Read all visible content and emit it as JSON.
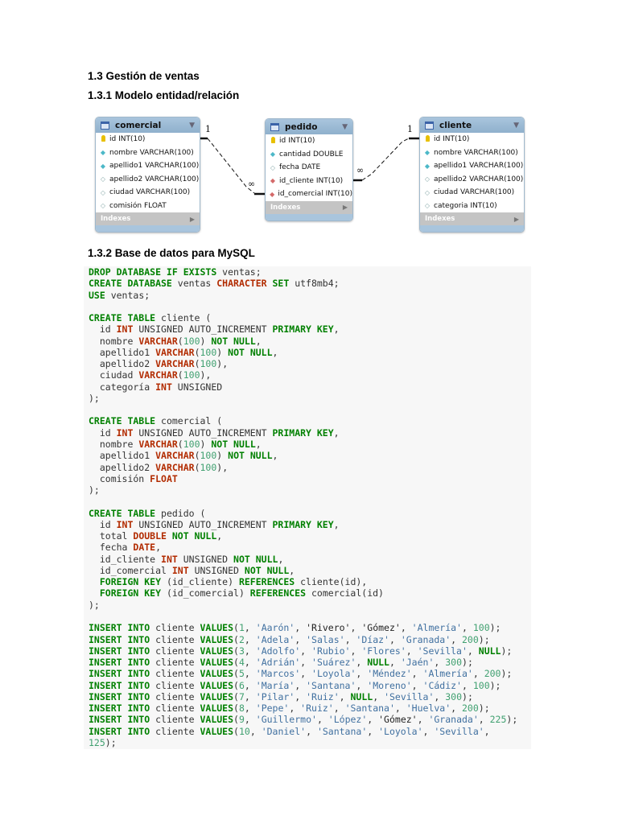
{
  "headings": {
    "section": "1.3 Gestión de ventas",
    "er_model": "1.3.1 Modelo entidad/relación",
    "mysql": "1.3.2 Base de datos para MySQL"
  },
  "diagram": {
    "indexes_label": "Indexes",
    "relations": [
      {
        "from": "comercial",
        "to": "pedido",
        "one_label": "1",
        "many_label": "∞"
      },
      {
        "from": "cliente",
        "to": "pedido",
        "one_label": "1",
        "many_label": "∞"
      }
    ],
    "entities": [
      {
        "name": "comercial",
        "columns": [
          {
            "icon": "key",
            "text": "id INT(10)"
          },
          {
            "icon": "nn",
            "text": "nombre VARCHAR(100)"
          },
          {
            "icon": "nn",
            "text": "apellido1 VARCHAR(100)"
          },
          {
            "icon": "nul",
            "text": "apellido2 VARCHAR(100)"
          },
          {
            "icon": "nul",
            "text": "ciudad VARCHAR(100)"
          },
          {
            "icon": "nul",
            "text": "comisión FLOAT"
          }
        ]
      },
      {
        "name": "pedido",
        "columns": [
          {
            "icon": "key",
            "text": "id INT(10)"
          },
          {
            "icon": "nn",
            "text": "cantidad DOUBLE"
          },
          {
            "icon": "nul",
            "text": "fecha DATE"
          },
          {
            "icon": "fk",
            "text": "id_cliente INT(10)"
          },
          {
            "icon": "fk",
            "text": "id_comercial INT(10)"
          }
        ]
      },
      {
        "name": "cliente",
        "columns": [
          {
            "icon": "key",
            "text": "id INT(10)"
          },
          {
            "icon": "nn",
            "text": "nombre VARCHAR(100)"
          },
          {
            "icon": "nn",
            "text": "apellido1 VARCHAR(100)"
          },
          {
            "icon": "nul",
            "text": "apellido2 VARCHAR(100)"
          },
          {
            "icon": "nul",
            "text": "ciudad VARCHAR(100)"
          },
          {
            "icon": "nul",
            "text": "categoria INT(10)"
          }
        ]
      }
    ]
  },
  "code": {
    "colors": {
      "keyword": "#008000",
      "type": "#b22b00",
      "number": "#40a070",
      "string": "#4070a0",
      "background": "#f7f7f7"
    },
    "lines": [
      [
        [
          "k",
          "DROP DATABASE IF EXISTS"
        ],
        [
          "p",
          " ventas;"
        ]
      ],
      [
        [
          "k",
          "CREATE DATABASE"
        ],
        [
          "p",
          " ventas "
        ],
        [
          "t",
          "CHARACTER"
        ],
        [
          "k",
          " SET"
        ],
        [
          "p",
          " utf8mb4;"
        ]
      ],
      [
        [
          "k",
          "USE"
        ],
        [
          "p",
          " ventas;"
        ]
      ],
      [],
      [
        [
          "k",
          "CREATE TABLE"
        ],
        [
          "p",
          " cliente ("
        ]
      ],
      [
        [
          "p",
          "  id "
        ],
        [
          "t",
          "INT"
        ],
        [
          "p",
          " UNSIGNED AUTO_INCREMENT "
        ],
        [
          "k",
          "PRIMARY KEY"
        ],
        [
          "p",
          ","
        ]
      ],
      [
        [
          "p",
          "  nombre "
        ],
        [
          "t",
          "VARCHAR"
        ],
        [
          "p",
          "("
        ],
        [
          "n",
          "100"
        ],
        [
          "p",
          ") "
        ],
        [
          "k",
          "NOT NULL"
        ],
        [
          "p",
          ","
        ]
      ],
      [
        [
          "p",
          "  apellido1 "
        ],
        [
          "t",
          "VARCHAR"
        ],
        [
          "p",
          "("
        ],
        [
          "n",
          "100"
        ],
        [
          "p",
          ") "
        ],
        [
          "k",
          "NOT NULL"
        ],
        [
          "p",
          ","
        ]
      ],
      [
        [
          "p",
          "  apellido2 "
        ],
        [
          "t",
          "VARCHAR"
        ],
        [
          "p",
          "("
        ],
        [
          "n",
          "100"
        ],
        [
          "p",
          "),"
        ]
      ],
      [
        [
          "p",
          "  ciudad "
        ],
        [
          "t",
          "VARCHAR"
        ],
        [
          "p",
          "("
        ],
        [
          "n",
          "100"
        ],
        [
          "p",
          "),"
        ]
      ],
      [
        [
          "p",
          "  categoría "
        ],
        [
          "t",
          "INT"
        ],
        [
          "p",
          " UNSIGNED"
        ]
      ],
      [
        [
          "p",
          ");"
        ]
      ],
      [],
      [
        [
          "k",
          "CREATE TABLE"
        ],
        [
          "p",
          " comercial ("
        ]
      ],
      [
        [
          "p",
          "  id "
        ],
        [
          "t",
          "INT"
        ],
        [
          "p",
          " UNSIGNED AUTO_INCREMENT "
        ],
        [
          "k",
          "PRIMARY KEY"
        ],
        [
          "p",
          ","
        ]
      ],
      [
        [
          "p",
          "  nombre "
        ],
        [
          "t",
          "VARCHAR"
        ],
        [
          "p",
          "("
        ],
        [
          "n",
          "100"
        ],
        [
          "p",
          ") "
        ],
        [
          "k",
          "NOT NULL"
        ],
        [
          "p",
          ","
        ]
      ],
      [
        [
          "p",
          "  apellido1 "
        ],
        [
          "t",
          "VARCHAR"
        ],
        [
          "p",
          "("
        ],
        [
          "n",
          "100"
        ],
        [
          "p",
          ") "
        ],
        [
          "k",
          "NOT NULL"
        ],
        [
          "p",
          ","
        ]
      ],
      [
        [
          "p",
          "  apellido2 "
        ],
        [
          "t",
          "VARCHAR"
        ],
        [
          "p",
          "("
        ],
        [
          "n",
          "100"
        ],
        [
          "p",
          "),"
        ]
      ],
      [
        [
          "p",
          "  comisión "
        ],
        [
          "t",
          "FLOAT"
        ]
      ],
      [
        [
          "p",
          ");"
        ]
      ],
      [],
      [
        [
          "k",
          "CREATE TABLE"
        ],
        [
          "p",
          " pedido ("
        ]
      ],
      [
        [
          "p",
          "  id "
        ],
        [
          "t",
          "INT"
        ],
        [
          "p",
          " UNSIGNED AUTO_INCREMENT "
        ],
        [
          "k",
          "PRIMARY KEY"
        ],
        [
          "p",
          ","
        ]
      ],
      [
        [
          "p",
          "  total "
        ],
        [
          "t",
          "DOUBLE"
        ],
        [
          "k",
          " NOT NULL"
        ],
        [
          "p",
          ","
        ]
      ],
      [
        [
          "p",
          "  fecha "
        ],
        [
          "t",
          "DATE"
        ],
        [
          "p",
          ","
        ]
      ],
      [
        [
          "p",
          "  id_cliente "
        ],
        [
          "t",
          "INT"
        ],
        [
          "p",
          " UNSIGNED "
        ],
        [
          "k",
          "NOT NULL"
        ],
        [
          "p",
          ","
        ]
      ],
      [
        [
          "p",
          "  id_comercial "
        ],
        [
          "t",
          "INT"
        ],
        [
          "p",
          " UNSIGNED "
        ],
        [
          "k",
          "NOT NULL"
        ],
        [
          "p",
          ","
        ]
      ],
      [
        [
          "k",
          "  FOREIGN KEY"
        ],
        [
          "p",
          " (id_cliente) "
        ],
        [
          "k",
          "REFERENCES"
        ],
        [
          "p",
          " cliente(id),"
        ]
      ],
      [
        [
          "k",
          "  FOREIGN KEY"
        ],
        [
          "p",
          " (id_comercial) "
        ],
        [
          "k",
          "REFERENCES"
        ],
        [
          "p",
          " comercial(id)"
        ]
      ],
      [
        [
          "p",
          ");"
        ]
      ],
      [],
      [
        [
          "k",
          "INSERT INTO"
        ],
        [
          "p",
          " cliente "
        ],
        [
          "k",
          "VALUES"
        ],
        [
          "p",
          "("
        ],
        [
          "n",
          "1"
        ],
        [
          "p",
          ", "
        ],
        [
          "s",
          "'Aarón'"
        ],
        [
          "p",
          ", "
        ],
        [
          "d",
          "'Rivero'"
        ],
        [
          "p",
          ", "
        ],
        [
          "d",
          "'Gómez'"
        ],
        [
          "p",
          ", "
        ],
        [
          "s",
          "'Almería'"
        ],
        [
          "p",
          ", "
        ],
        [
          "n",
          "100"
        ],
        [
          "p",
          ");"
        ]
      ],
      [
        [
          "k",
          "INSERT INTO"
        ],
        [
          "p",
          " cliente "
        ],
        [
          "k",
          "VALUES"
        ],
        [
          "p",
          "("
        ],
        [
          "n",
          "2"
        ],
        [
          "p",
          ", "
        ],
        [
          "s",
          "'Adela'"
        ],
        [
          "p",
          ", "
        ],
        [
          "s",
          "'Salas'"
        ],
        [
          "p",
          ", "
        ],
        [
          "s",
          "'Díaz'"
        ],
        [
          "p",
          ", "
        ],
        [
          "s",
          "'Granada'"
        ],
        [
          "p",
          ", "
        ],
        [
          "n",
          "200"
        ],
        [
          "p",
          ");"
        ]
      ],
      [
        [
          "k",
          "INSERT INTO"
        ],
        [
          "p",
          " cliente "
        ],
        [
          "k",
          "VALUES"
        ],
        [
          "p",
          "("
        ],
        [
          "n",
          "3"
        ],
        [
          "p",
          ", "
        ],
        [
          "s",
          "'Adolfo'"
        ],
        [
          "p",
          ", "
        ],
        [
          "s",
          "'Rubio'"
        ],
        [
          "p",
          ", "
        ],
        [
          "s",
          "'Flores'"
        ],
        [
          "p",
          ", "
        ],
        [
          "s",
          "'Sevilla'"
        ],
        [
          "p",
          ", "
        ],
        [
          "k",
          "NULL"
        ],
        [
          "p",
          ");"
        ]
      ],
      [
        [
          "k",
          "INSERT INTO"
        ],
        [
          "p",
          " cliente "
        ],
        [
          "k",
          "VALUES"
        ],
        [
          "p",
          "("
        ],
        [
          "n",
          "4"
        ],
        [
          "p",
          ", "
        ],
        [
          "s",
          "'Adrián'"
        ],
        [
          "p",
          ", "
        ],
        [
          "s",
          "'Suárez'"
        ],
        [
          "p",
          ", "
        ],
        [
          "k",
          "NULL"
        ],
        [
          "p",
          ", "
        ],
        [
          "s",
          "'Jaén'"
        ],
        [
          "p",
          ", "
        ],
        [
          "n",
          "300"
        ],
        [
          "p",
          ");"
        ]
      ],
      [
        [
          "k",
          "INSERT INTO"
        ],
        [
          "p",
          " cliente "
        ],
        [
          "k",
          "VALUES"
        ],
        [
          "p",
          "("
        ],
        [
          "n",
          "5"
        ],
        [
          "p",
          ", "
        ],
        [
          "s",
          "'Marcos'"
        ],
        [
          "p",
          ", "
        ],
        [
          "s",
          "'Loyola'"
        ],
        [
          "p",
          ", "
        ],
        [
          "s",
          "'Méndez'"
        ],
        [
          "p",
          ", "
        ],
        [
          "s",
          "'Almería'"
        ],
        [
          "p",
          ", "
        ],
        [
          "n",
          "200"
        ],
        [
          "p",
          ");"
        ]
      ],
      [
        [
          "k",
          "INSERT INTO"
        ],
        [
          "p",
          " cliente "
        ],
        [
          "k",
          "VALUES"
        ],
        [
          "p",
          "("
        ],
        [
          "n",
          "6"
        ],
        [
          "p",
          ", "
        ],
        [
          "s",
          "'María'"
        ],
        [
          "p",
          ", "
        ],
        [
          "s",
          "'Santana'"
        ],
        [
          "p",
          ", "
        ],
        [
          "s",
          "'Moreno'"
        ],
        [
          "p",
          ", "
        ],
        [
          "s",
          "'Cádiz'"
        ],
        [
          "p",
          ", "
        ],
        [
          "n",
          "100"
        ],
        [
          "p",
          ");"
        ]
      ],
      [
        [
          "k",
          "INSERT INTO"
        ],
        [
          "p",
          " cliente "
        ],
        [
          "k",
          "VALUES"
        ],
        [
          "p",
          "("
        ],
        [
          "n",
          "7"
        ],
        [
          "p",
          ", "
        ],
        [
          "s",
          "'Pilar'"
        ],
        [
          "p",
          ", "
        ],
        [
          "s",
          "'Ruiz'"
        ],
        [
          "p",
          ", "
        ],
        [
          "k",
          "NULL"
        ],
        [
          "p",
          ", "
        ],
        [
          "s",
          "'Sevilla'"
        ],
        [
          "p",
          ", "
        ],
        [
          "n",
          "300"
        ],
        [
          "p",
          ");"
        ]
      ],
      [
        [
          "k",
          "INSERT INTO"
        ],
        [
          "p",
          " cliente "
        ],
        [
          "k",
          "VALUES"
        ],
        [
          "p",
          "("
        ],
        [
          "n",
          "8"
        ],
        [
          "p",
          ", "
        ],
        [
          "s",
          "'Pepe'"
        ],
        [
          "p",
          ", "
        ],
        [
          "s",
          "'Ruiz'"
        ],
        [
          "p",
          ", "
        ],
        [
          "s",
          "'Santana'"
        ],
        [
          "p",
          ", "
        ],
        [
          "s",
          "'Huelva'"
        ],
        [
          "p",
          ", "
        ],
        [
          "n",
          "200"
        ],
        [
          "p",
          ");"
        ]
      ],
      [
        [
          "k",
          "INSERT INTO"
        ],
        [
          "p",
          " cliente "
        ],
        [
          "k",
          "VALUES"
        ],
        [
          "p",
          "("
        ],
        [
          "n",
          "9"
        ],
        [
          "p",
          ", "
        ],
        [
          "s",
          "'Guillermo'"
        ],
        [
          "p",
          ", "
        ],
        [
          "s",
          "'López'"
        ],
        [
          "p",
          ", "
        ],
        [
          "d",
          "'Gómez'"
        ],
        [
          "p",
          ", "
        ],
        [
          "s",
          "'Granada'"
        ],
        [
          "p",
          ", "
        ],
        [
          "n",
          "225"
        ],
        [
          "p",
          ");"
        ]
      ],
      [
        [
          "k",
          "INSERT INTO"
        ],
        [
          "p",
          " cliente "
        ],
        [
          "k",
          "VALUES"
        ],
        [
          "p",
          "("
        ],
        [
          "n",
          "10"
        ],
        [
          "p",
          ", "
        ],
        [
          "s",
          "'Daniel'"
        ],
        [
          "p",
          ", "
        ],
        [
          "s",
          "'Santana'"
        ],
        [
          "p",
          ", "
        ],
        [
          "s",
          "'Loyola'"
        ],
        [
          "p",
          ", "
        ],
        [
          "s",
          "'Sevilla'"
        ],
        [
          "p",
          ","
        ]
      ],
      [
        [
          "n",
          "125"
        ],
        [
          "p",
          ");"
        ]
      ]
    ]
  }
}
